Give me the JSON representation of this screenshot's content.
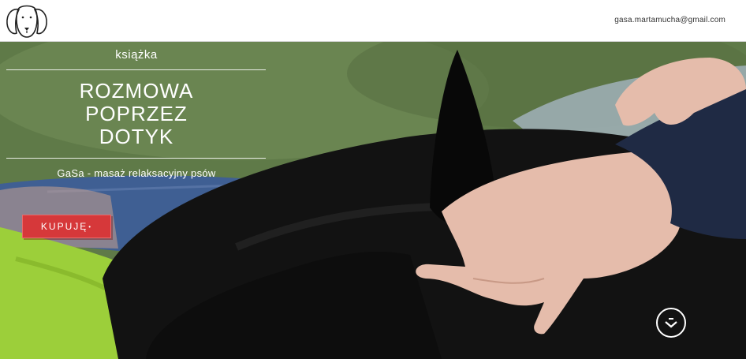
{
  "header": {
    "logo": "dog-face-logo",
    "email": "gasa.martamucha@gmail.com"
  },
  "hero": {
    "label": "książka",
    "title_lines": [
      "ROZMOWA",
      "POPRZEZ",
      "DOTYK"
    ],
    "subtitle": "GaSa - masaż relaksacyjny psów",
    "buy_label": "KUPUJĘ",
    "scroll_icon": "chevron-down-circle-icon",
    "background_image": "hands-massaging-black-dog-on-grass",
    "colors": {
      "button": "#d6383a",
      "text": "#ffffff"
    }
  }
}
